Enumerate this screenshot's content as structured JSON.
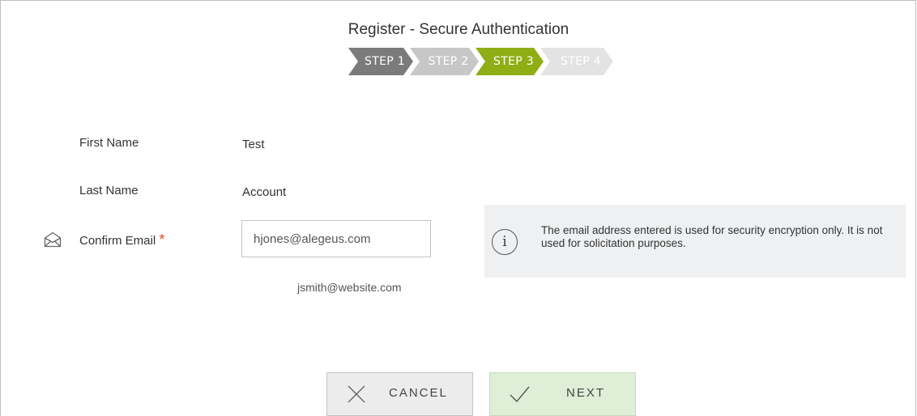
{
  "header": {
    "title": "Register - Secure Authentication",
    "steps": [
      {
        "label": "STEP 1",
        "state": "completed",
        "color": "#7b7b7b"
      },
      {
        "label": "STEP 2",
        "state": "completed",
        "color": "#c7c7c7"
      },
      {
        "label": "STEP 3",
        "state": "current",
        "color": "#8fad15"
      },
      {
        "label": "STEP 4",
        "state": "upcoming",
        "color": "#e3e3e3"
      }
    ]
  },
  "form": {
    "first_name_label": "First Name",
    "first_name_value": "Test",
    "last_name_label": "Last Name",
    "last_name_value": "Account",
    "confirm_email_label": "Confirm Email",
    "required_marker": "*",
    "email_value": "hjones@alegeus.com",
    "email_hint": "jsmith@website.com",
    "email_icon": "envelope-icon"
  },
  "info": {
    "icon": "info-icon",
    "icon_glyph": "i",
    "text": "The email address entered is used for security encryption only. It is not used for solicitation purposes."
  },
  "actions": {
    "cancel_label": "CANCEL",
    "cancel_icon": "close-icon",
    "next_label": "NEXT",
    "next_icon": "checkmark-icon"
  },
  "colors": {
    "accent": "#8fad15",
    "required": "#e04a2b",
    "next_button": "#dfeed6"
  }
}
